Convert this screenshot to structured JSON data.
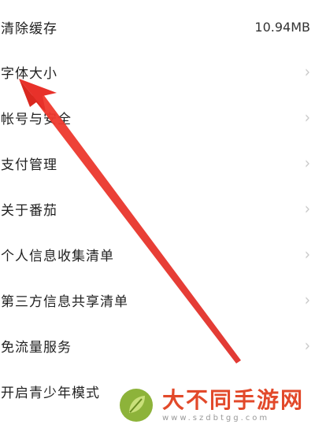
{
  "settings": {
    "items": [
      {
        "label": "清除缓存",
        "value": "10.94MB",
        "chevron": false
      },
      {
        "label": "字体大小",
        "value": "",
        "chevron": true
      },
      {
        "label": "帐号与安全",
        "value": "",
        "chevron": true
      },
      {
        "label": "支付管理",
        "value": "",
        "chevron": true
      },
      {
        "label": "关于番茄",
        "value": "",
        "chevron": true
      },
      {
        "label": "个人信息收集清单",
        "value": "",
        "chevron": true
      },
      {
        "label": "第三方信息共享清单",
        "value": "",
        "chevron": true
      },
      {
        "label": "免流量服务",
        "value": "",
        "chevron": true
      },
      {
        "label": "开启青少年模式",
        "value": "",
        "chevron": false
      }
    ],
    "chevron_glyph": "›"
  },
  "annotation": {
    "icon": "red-arrow-icon",
    "color": "#e8312a"
  },
  "watermark": {
    "title": "大不同手游网",
    "url": "www.szdbtgg.com",
    "color": "#e2492a"
  }
}
